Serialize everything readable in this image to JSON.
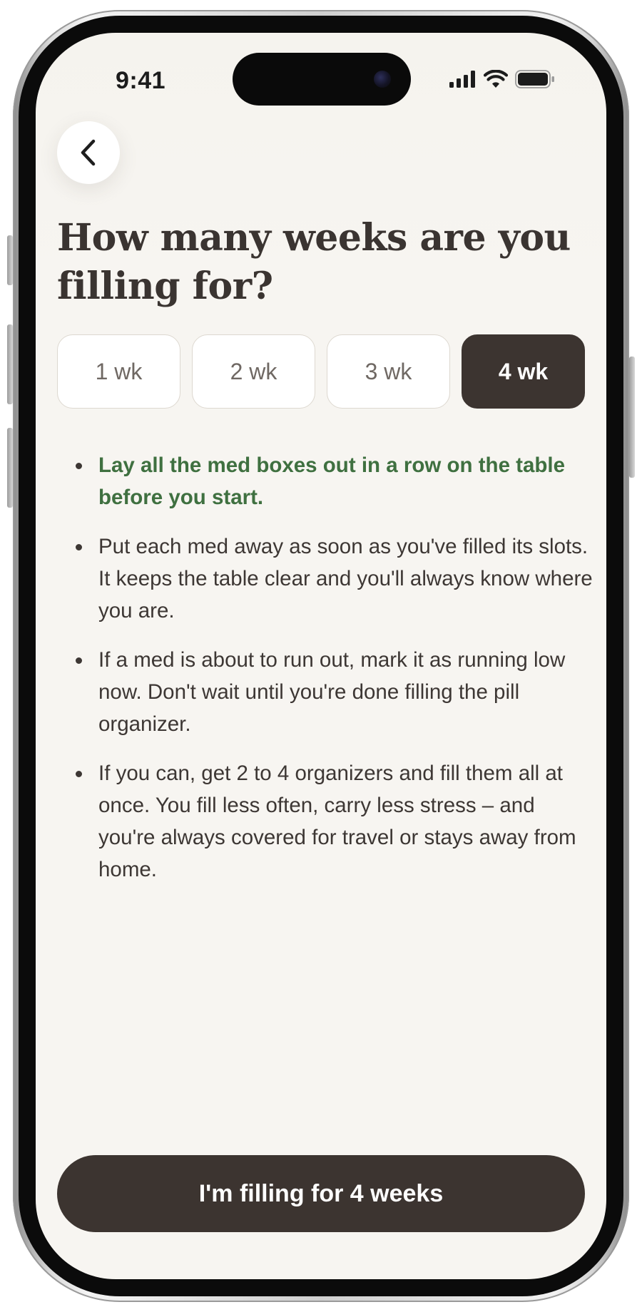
{
  "status_bar": {
    "time": "9:41"
  },
  "header": {
    "back_icon": "chevron-left-icon"
  },
  "title": "How many weeks are you filling for?",
  "week_options": [
    {
      "label": "1 wk",
      "selected": false
    },
    {
      "label": "2 wk",
      "selected": false
    },
    {
      "label": "3 wk",
      "selected": false
    },
    {
      "label": "4 wk",
      "selected": true
    }
  ],
  "tips": [
    {
      "text": "Lay all the med boxes out in a row on the table before you start.",
      "highlight": true
    },
    {
      "text": "Put each med away as soon as you've filled its slots. It keeps the table clear and you'll always know where you are.",
      "highlight": false
    },
    {
      "text": "If a med is about to run out, mark it as running low now. Don't wait until you're done filling the pill organizer.",
      "highlight": false
    },
    {
      "text": "If you can, get 2 to 4 organizers and fill them all at once. You fill less often, carry less stress – and you're always covered for travel or stays away from home.",
      "highlight": false
    }
  ],
  "cta": {
    "label": "I'm filling for 4 weeks"
  },
  "colors": {
    "background": "#f7f5f1",
    "primary_dark": "#3c3430",
    "highlight_green": "#3f7040",
    "text": "#3d3734"
  }
}
